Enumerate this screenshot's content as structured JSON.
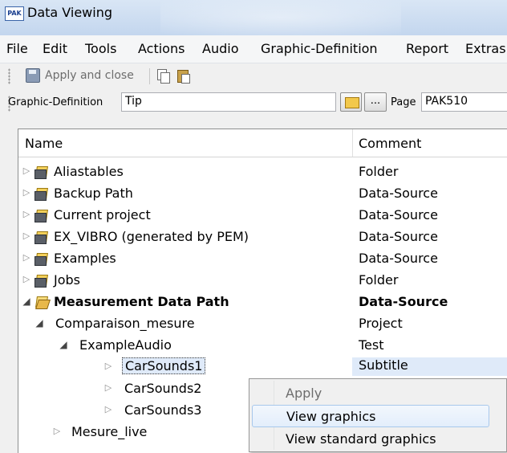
{
  "window": {
    "title": "Data Viewing",
    "app_icon_text": "PAK"
  },
  "menu": [
    "File",
    "Edit",
    "Tools",
    "Actions",
    "Audio",
    "Graphic-Definition",
    "Report",
    "Extras"
  ],
  "toolbar": {
    "apply_close_label": "Apply and close"
  },
  "graphic_definition": {
    "label": "Graphic-Definition",
    "value": "Tip",
    "browse_label": "...",
    "page_label": "Page",
    "page_value": "PAK510"
  },
  "tree": {
    "columns": {
      "name": "Name",
      "comment": "Comment"
    },
    "rows": [
      {
        "name": "Aliastables",
        "comment": "Folder"
      },
      {
        "name": "Backup Path",
        "comment": "Data-Source"
      },
      {
        "name": "Current project",
        "comment": "Data-Source"
      },
      {
        "name": "EX_VIBRO (generated by PEM)",
        "comment": "Data-Source"
      },
      {
        "name": "Examples",
        "comment": "Data-Source"
      },
      {
        "name": "Jobs",
        "comment": "Folder"
      },
      {
        "name": "Measurement Data Path",
        "comment": "Data-Source"
      },
      {
        "name": "Comparaison_mesure",
        "comment": "Project"
      },
      {
        "name": "ExampleAudio",
        "comment": "Test"
      },
      {
        "name": "CarSounds1",
        "comment": "Subtitle"
      },
      {
        "name": "CarSounds2",
        "comment": ""
      },
      {
        "name": "CarSounds3",
        "comment": ""
      },
      {
        "name": "Mesure_live",
        "comment": ""
      }
    ]
  },
  "context_menu": {
    "items": [
      "Apply",
      "View graphics",
      "View standard graphics"
    ]
  }
}
